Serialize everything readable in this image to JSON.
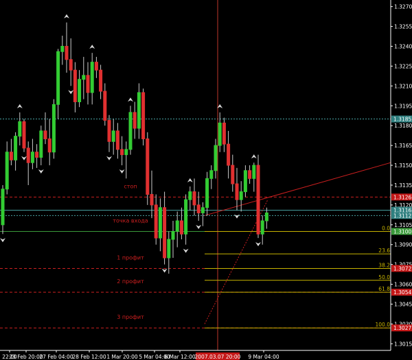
{
  "chart_data": {
    "type": "candlestick",
    "symbol_hint": "",
    "title": "",
    "ylim": [
      1.301,
      1.3275
    ],
    "y_ticks": [
      "1.3270",
      "1.3255",
      "1.3240",
      "1.3225",
      "1.3210",
      "1.3195",
      "1.3180",
      "1.3165",
      "1.3150",
      "1.3135",
      "1.3120",
      "1.3105",
      "1.3090",
      "1.3075",
      "1.3060",
      "1.3045",
      "1.3030",
      "1.3015"
    ],
    "x_ticks": [
      "22:00",
      "23 Feb 20:00",
      "27 Feb 04:00",
      "28 Feb 12:00",
      "1 Mar 20:00",
      "5 Mar 04:00",
      "6 Mar 12:00",
      "9 Mar 04:00"
    ],
    "crosshair_time": "2007.03.07 20:00",
    "colors": {
      "background": "#000000",
      "axis": "#ffffff",
      "bull": "#33cc33",
      "bear": "#e03030",
      "fractal": "#d8d8d8",
      "level_red": "#cc2020",
      "level_cyan": "#49a5a5",
      "level_green": "#3a9a3a",
      "fibo": "#c8b400",
      "trend": "#cc1f1f",
      "crosshair": "#c0392b"
    },
    "levels": [
      {
        "name": "стоп",
        "price": 1.3126,
        "style": "dashed",
        "color": "level_red",
        "label_price": "1.3126"
      },
      {
        "name": "",
        "price": 1.3185,
        "style": "dotted",
        "color": "level_cyan",
        "label_price": "1.3185"
      },
      {
        "name": "",
        "price": 1.3116,
        "style": "solid",
        "color": "level_cyan",
        "label_price": "1.3116"
      },
      {
        "name": "",
        "price": 1.3112,
        "style": "dotted",
        "color": "level_cyan",
        "label_price": "1.3112"
      },
      {
        "name": "точка входа",
        "price": 1.31,
        "style": "solid",
        "color": "level_green",
        "label_price": "1.3100"
      },
      {
        "name": "1 профит",
        "price": 1.3072,
        "style": "dashed",
        "color": "level_red",
        "label_price": "1.3072"
      },
      {
        "name": "2 профит",
        "price": 1.3054,
        "style": "dashed",
        "color": "level_red",
        "label_price": "1.3054"
      },
      {
        "name": "3 профит",
        "price": 1.3027,
        "style": "dashed",
        "color": "level_red",
        "label_price": "1.3027"
      }
    ],
    "fibo": [
      {
        "ratio": "0.0",
        "price": 1.31
      },
      {
        "ratio": "23.6",
        "price": 1.3083
      },
      {
        "ratio": "38.2",
        "price": 1.3072
      },
      {
        "ratio": "50.0",
        "price": 1.3063
      },
      {
        "ratio": "61.8",
        "price": 1.3054
      },
      {
        "ratio": "100.0",
        "price": 1.3027
      }
    ],
    "candles": [
      {
        "o": 1.3105,
        "h": 1.3135,
        "l": 1.3098,
        "c": 1.3132
      },
      {
        "o": 1.3132,
        "h": 1.3168,
        "l": 1.3128,
        "c": 1.316
      },
      {
        "o": 1.316,
        "h": 1.317,
        "l": 1.315,
        "c": 1.3154
      },
      {
        "o": 1.3154,
        "h": 1.3175,
        "l": 1.3146,
        "c": 1.3172
      },
      {
        "o": 1.3172,
        "h": 1.319,
        "l": 1.3165,
        "c": 1.3183
      },
      {
        "o": 1.3183,
        "h": 1.3185,
        "l": 1.316,
        "c": 1.3163
      },
      {
        "o": 1.3163,
        "h": 1.3168,
        "l": 1.3135,
        "c": 1.3152
      },
      {
        "o": 1.3152,
        "h": 1.317,
        "l": 1.3147,
        "c": 1.316
      },
      {
        "o": 1.316,
        "h": 1.3166,
        "l": 1.3148,
        "c": 1.3156
      },
      {
        "o": 1.3156,
        "h": 1.318,
        "l": 1.315,
        "c": 1.3176
      },
      {
        "o": 1.3176,
        "h": 1.319,
        "l": 1.3166,
        "c": 1.317
      },
      {
        "o": 1.317,
        "h": 1.3185,
        "l": 1.315,
        "c": 1.316
      },
      {
        "o": 1.316,
        "h": 1.32,
        "l": 1.3155,
        "c": 1.3196
      },
      {
        "o": 1.3196,
        "h": 1.3238,
        "l": 1.3185,
        "c": 1.3236
      },
      {
        "o": 1.3236,
        "h": 1.3248,
        "l": 1.3226,
        "c": 1.324
      },
      {
        "o": 1.324,
        "h": 1.3258,
        "l": 1.322,
        "c": 1.323
      },
      {
        "o": 1.323,
        "h": 1.3246,
        "l": 1.321,
        "c": 1.3222
      },
      {
        "o": 1.3222,
        "h": 1.3228,
        "l": 1.319,
        "c": 1.3198
      },
      {
        "o": 1.3198,
        "h": 1.3222,
        "l": 1.3194,
        "c": 1.3215
      },
      {
        "o": 1.3215,
        "h": 1.3232,
        "l": 1.32,
        "c": 1.3218
      },
      {
        "o": 1.3218,
        "h": 1.3228,
        "l": 1.3196,
        "c": 1.3205
      },
      {
        "o": 1.3205,
        "h": 1.3235,
        "l": 1.3196,
        "c": 1.3228
      },
      {
        "o": 1.3228,
        "h": 1.3232,
        "l": 1.3216,
        "c": 1.3222
      },
      {
        "o": 1.3222,
        "h": 1.3226,
        "l": 1.32,
        "c": 1.3206
      },
      {
        "o": 1.3206,
        "h": 1.3212,
        "l": 1.318,
        "c": 1.3184
      },
      {
        "o": 1.3184,
        "h": 1.3188,
        "l": 1.316,
        "c": 1.3168
      },
      {
        "o": 1.3168,
        "h": 1.3185,
        "l": 1.3158,
        "c": 1.3176
      },
      {
        "o": 1.3176,
        "h": 1.3182,
        "l": 1.3155,
        "c": 1.3162
      },
      {
        "o": 1.3162,
        "h": 1.3172,
        "l": 1.315,
        "c": 1.3158
      },
      {
        "o": 1.3158,
        "h": 1.3168,
        "l": 1.314,
        "c": 1.3162
      },
      {
        "o": 1.3162,
        "h": 1.3195,
        "l": 1.3158,
        "c": 1.319
      },
      {
        "o": 1.319,
        "h": 1.3198,
        "l": 1.317,
        "c": 1.3178
      },
      {
        "o": 1.3178,
        "h": 1.3212,
        "l": 1.317,
        "c": 1.3205
      },
      {
        "o": 1.3205,
        "h": 1.3208,
        "l": 1.3165,
        "c": 1.317
      },
      {
        "o": 1.317,
        "h": 1.3175,
        "l": 1.312,
        "c": 1.3128
      },
      {
        "o": 1.3128,
        "h": 1.3146,
        "l": 1.311,
        "c": 1.312
      },
      {
        "o": 1.312,
        "h": 1.3128,
        "l": 1.309,
        "c": 1.3095
      },
      {
        "o": 1.3095,
        "h": 1.3125,
        "l": 1.3085,
        "c": 1.3118
      },
      {
        "o": 1.3118,
        "h": 1.313,
        "l": 1.3075,
        "c": 1.308
      },
      {
        "o": 1.308,
        "h": 1.31,
        "l": 1.3068,
        "c": 1.3094
      },
      {
        "o": 1.3094,
        "h": 1.3108,
        "l": 1.308,
        "c": 1.31
      },
      {
        "o": 1.31,
        "h": 1.3115,
        "l": 1.3088,
        "c": 1.3108
      },
      {
        "o": 1.3108,
        "h": 1.3118,
        "l": 1.3094,
        "c": 1.3098
      },
      {
        "o": 1.3098,
        "h": 1.3128,
        "l": 1.309,
        "c": 1.3124
      },
      {
        "o": 1.3124,
        "h": 1.3134,
        "l": 1.3116,
        "c": 1.313
      },
      {
        "o": 1.313,
        "h": 1.314,
        "l": 1.3112,
        "c": 1.312
      },
      {
        "o": 1.312,
        "h": 1.313,
        "l": 1.3108,
        "c": 1.3114
      },
      {
        "o": 1.3114,
        "h": 1.3122,
        "l": 1.3104,
        "c": 1.3118
      },
      {
        "o": 1.3118,
        "h": 1.3145,
        "l": 1.3112,
        "c": 1.314
      },
      {
        "o": 1.314,
        "h": 1.315,
        "l": 1.3132,
        "c": 1.3146
      },
      {
        "o": 1.3146,
        "h": 1.317,
        "l": 1.314,
        "c": 1.3165
      },
      {
        "o": 1.3165,
        "h": 1.319,
        "l": 1.316,
        "c": 1.3182
      },
      {
        "o": 1.3182,
        "h": 1.3186,
        "l": 1.316,
        "c": 1.3166
      },
      {
        "o": 1.3166,
        "h": 1.3176,
        "l": 1.314,
        "c": 1.315
      },
      {
        "o": 1.315,
        "h": 1.3158,
        "l": 1.313,
        "c": 1.3136
      },
      {
        "o": 1.3136,
        "h": 1.3148,
        "l": 1.3116,
        "c": 1.3124
      },
      {
        "o": 1.3124,
        "h": 1.3138,
        "l": 1.3115,
        "c": 1.313
      },
      {
        "o": 1.313,
        "h": 1.315,
        "l": 1.3126,
        "c": 1.3146
      },
      {
        "o": 1.3146,
        "h": 1.315,
        "l": 1.3136,
        "c": 1.314
      },
      {
        "o": 1.314,
        "h": 1.3152,
        "l": 1.313,
        "c": 1.315
      },
      {
        "o": 1.315,
        "h": 1.3158,
        "l": 1.3095,
        "c": 1.3098
      },
      {
        "o": 1.3098,
        "h": 1.3112,
        "l": 1.309,
        "c": 1.3108
      },
      {
        "o": 1.3108,
        "h": 1.3118,
        "l": 1.3102,
        "c": 1.3114
      }
    ],
    "fractals_up": [
      4,
      15,
      21,
      30,
      44,
      51,
      59
    ],
    "fractals_down": [
      0,
      5,
      9,
      16,
      25,
      28,
      38,
      43,
      46,
      55,
      60
    ]
  }
}
